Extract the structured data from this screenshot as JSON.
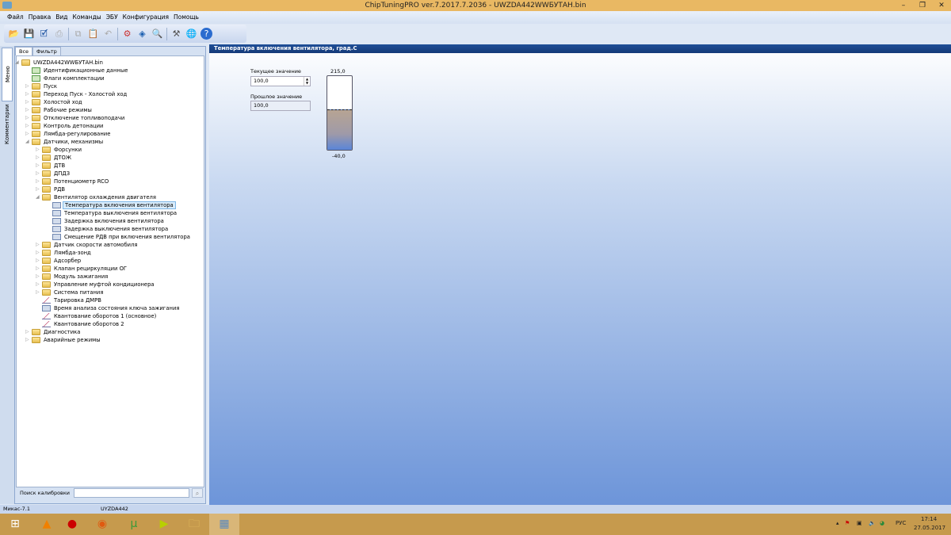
{
  "window": {
    "title": "ChipTuningPRO ver.7.2017.7.2036 - UWZDA442WWБУТАН.bin"
  },
  "menu": [
    "Файл",
    "Правка",
    "Вид",
    "Команды",
    "ЭБУ",
    "Конфигурация",
    "Помощь"
  ],
  "vtabs": [
    "Меню калибровок",
    "Комментарии"
  ],
  "tabs": [
    "Все",
    "Фильтр"
  ],
  "tree": [
    {
      "label": "UWZDA442WWБУТАН.bin",
      "level": 0,
      "icon": "folder",
      "arrow": "open"
    },
    {
      "label": "Идентификационные данные",
      "level": 1,
      "icon": "check"
    },
    {
      "label": "Флаги комплектации",
      "level": 1,
      "icon": "check"
    },
    {
      "label": "Пуск",
      "level": 1,
      "icon": "folder",
      "arrow": "closed"
    },
    {
      "label": "Переход Пуск - Холостой ход",
      "level": 1,
      "icon": "folder",
      "arrow": "closed"
    },
    {
      "label": "Холостой ход",
      "level": 1,
      "icon": "folder",
      "arrow": "closed"
    },
    {
      "label": "Рабочие режимы",
      "level": 1,
      "icon": "folder",
      "arrow": "closed"
    },
    {
      "label": "Отключение топливоподачи",
      "level": 1,
      "icon": "folder",
      "arrow": "closed"
    },
    {
      "label": "Контроль детонации",
      "level": 1,
      "icon": "folder",
      "arrow": "closed"
    },
    {
      "label": "Лямбда-регулирование",
      "level": 1,
      "icon": "folder",
      "arrow": "closed"
    },
    {
      "label": "Датчики, механизмы",
      "level": 1,
      "icon": "folder",
      "arrow": "open"
    },
    {
      "label": "Форсунки",
      "level": 2,
      "icon": "folder",
      "arrow": "closed"
    },
    {
      "label": "ДТОЖ",
      "level": 2,
      "icon": "folder",
      "arrow": "closed"
    },
    {
      "label": "ДТВ",
      "level": 2,
      "icon": "folder",
      "arrow": "closed"
    },
    {
      "label": "ДПДЗ",
      "level": 2,
      "icon": "folder",
      "arrow": "closed"
    },
    {
      "label": "Потенциометр RCO",
      "level": 2,
      "icon": "folder",
      "arrow": "closed"
    },
    {
      "label": "РДВ",
      "level": 2,
      "icon": "folder",
      "arrow": "closed"
    },
    {
      "label": "Вентилятор охлаждения двигателя",
      "level": 2,
      "icon": "folder",
      "arrow": "open"
    },
    {
      "label": "Температура включения вентилятора",
      "level": 3,
      "icon": "val",
      "selected": true
    },
    {
      "label": "Температура выключения вентилятора",
      "level": 3,
      "icon": "val"
    },
    {
      "label": "Задержка включения вентилятора",
      "level": 3,
      "icon": "val"
    },
    {
      "label": "Задержка выключения вентилятора",
      "level": 3,
      "icon": "val"
    },
    {
      "label": "Смещение РДВ при включения вентилятора",
      "level": 3,
      "icon": "val"
    },
    {
      "label": "Датчик скорости автомобиля",
      "level": 2,
      "icon": "folder",
      "arrow": "closed"
    },
    {
      "label": "Лямбда-зонд",
      "level": 2,
      "icon": "folder",
      "arrow": "closed"
    },
    {
      "label": "Адсорбер",
      "level": 2,
      "icon": "folder",
      "arrow": "closed"
    },
    {
      "label": "Клапан рециркуляции ОГ",
      "level": 2,
      "icon": "folder",
      "arrow": "closed"
    },
    {
      "label": "Модуль зажигания",
      "level": 2,
      "icon": "folder",
      "arrow": "closed"
    },
    {
      "label": "Управление муфтой кондиционера",
      "level": 2,
      "icon": "folder",
      "arrow": "closed"
    },
    {
      "label": "Система питания",
      "level": 2,
      "icon": "folder",
      "arrow": "closed"
    },
    {
      "label": "Тарировка ДМРВ",
      "level": 2,
      "icon": "graph"
    },
    {
      "label": "Время анализа состояния ключа зажигания",
      "level": 2,
      "icon": "val"
    },
    {
      "label": "Квантование оборотов 1 (основное)",
      "level": 2,
      "icon": "graph"
    },
    {
      "label": "Квантование оборотов 2",
      "level": 2,
      "icon": "graph"
    },
    {
      "label": "Диагностика",
      "level": 1,
      "icon": "folder",
      "arrow": "closed"
    },
    {
      "label": "Аварийные режимы",
      "level": 1,
      "icon": "folder",
      "arrow": "closed"
    }
  ],
  "search": {
    "label": "Поиск калибровки",
    "value": ""
  },
  "editor": {
    "title": "Температура включения вентилятора, град.С",
    "current_label": "Текущее значение",
    "current_value": "100,0",
    "previous_label": "Прошлое значение",
    "previous_value": "100,0",
    "gauge_max": "215,0",
    "gauge_min": "-40,0",
    "gauge_value": 100,
    "gauge_range": [
      -40,
      215
    ]
  },
  "status": {
    "ecu": "Микас-7.1",
    "id": "UYZDA442"
  },
  "tray": {
    "lang": "РУС",
    "time": "17:14",
    "date": "27.05.2017"
  }
}
